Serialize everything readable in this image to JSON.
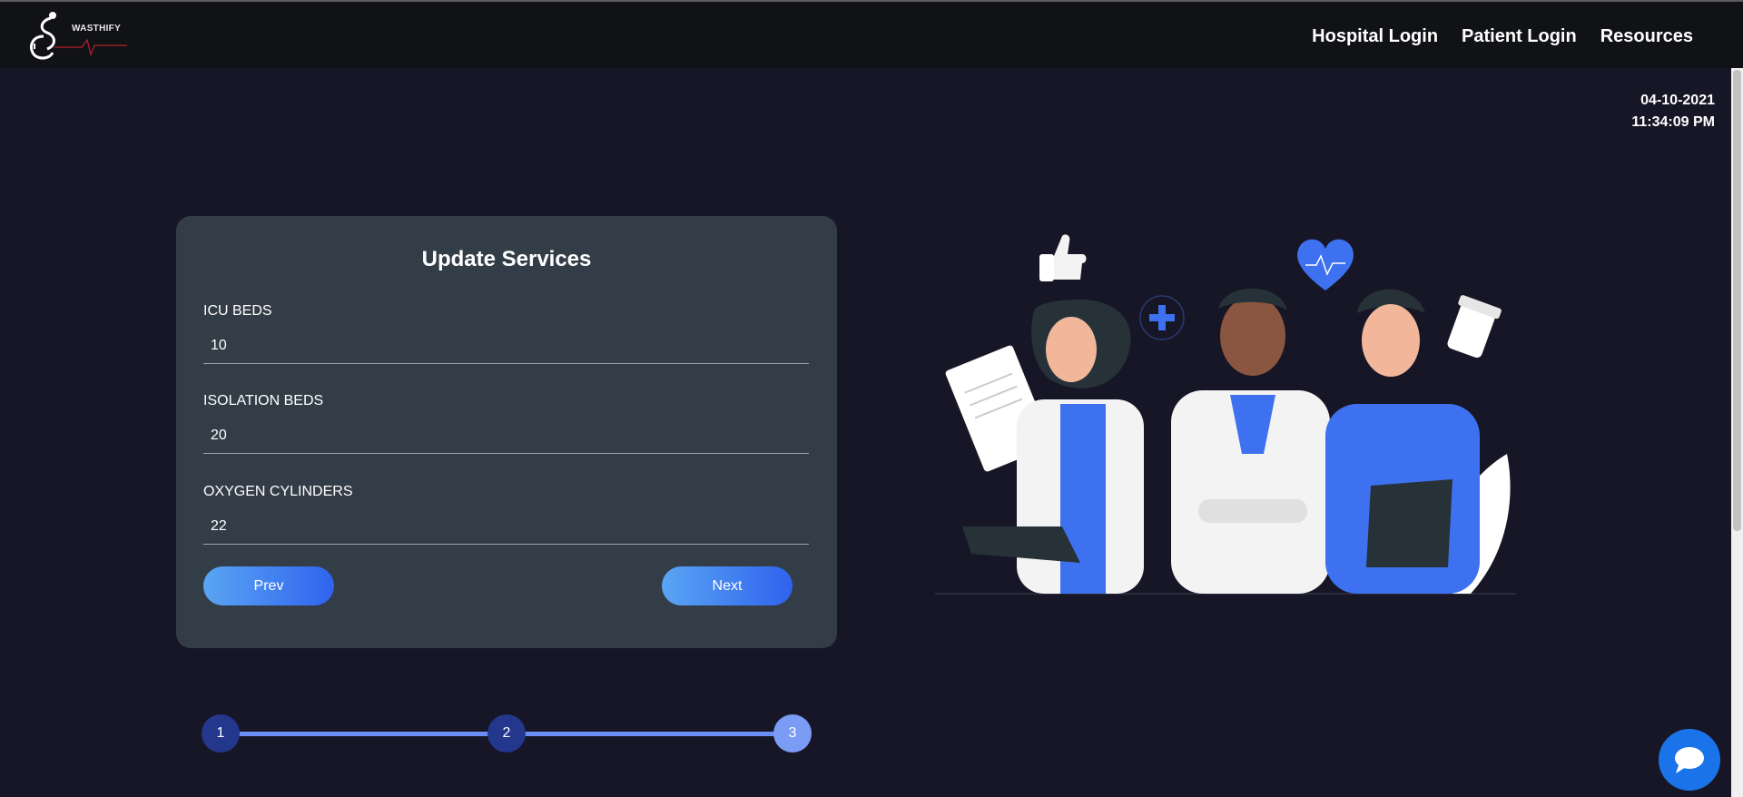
{
  "brand": {
    "name": "WASTHIFY",
    "logo_icon": "stethoscope-logo-icon"
  },
  "nav": {
    "items": [
      {
        "label": "Hospital Login"
      },
      {
        "label": "Patient Login"
      },
      {
        "label": "Resources"
      }
    ]
  },
  "clock": {
    "date": "04-10-2021",
    "time": "11:34:09 PM"
  },
  "form": {
    "title": "Update Services",
    "fields": [
      {
        "label": "ICU BEDS",
        "value": "10"
      },
      {
        "label": "ISOLATION BEDS",
        "value": "20"
      },
      {
        "label": "OXYGEN CYLINDERS",
        "value": "22"
      }
    ],
    "prev_label": "Prev",
    "next_label": "Next"
  },
  "stepper": {
    "steps": [
      {
        "label": "1"
      },
      {
        "label": "2"
      },
      {
        "label": "3"
      }
    ],
    "current_step": 3
  },
  "illustration": {
    "icon": "medical-team-illustration"
  },
  "chat": {
    "icon": "chat-bubble-icon"
  },
  "colors": {
    "background": "#171626",
    "topbar": "#111216",
    "card": "#333d48",
    "accent_blue": "#2f63ee",
    "step_active": "#7b9cf5",
    "step_inactive": "#23378c"
  }
}
